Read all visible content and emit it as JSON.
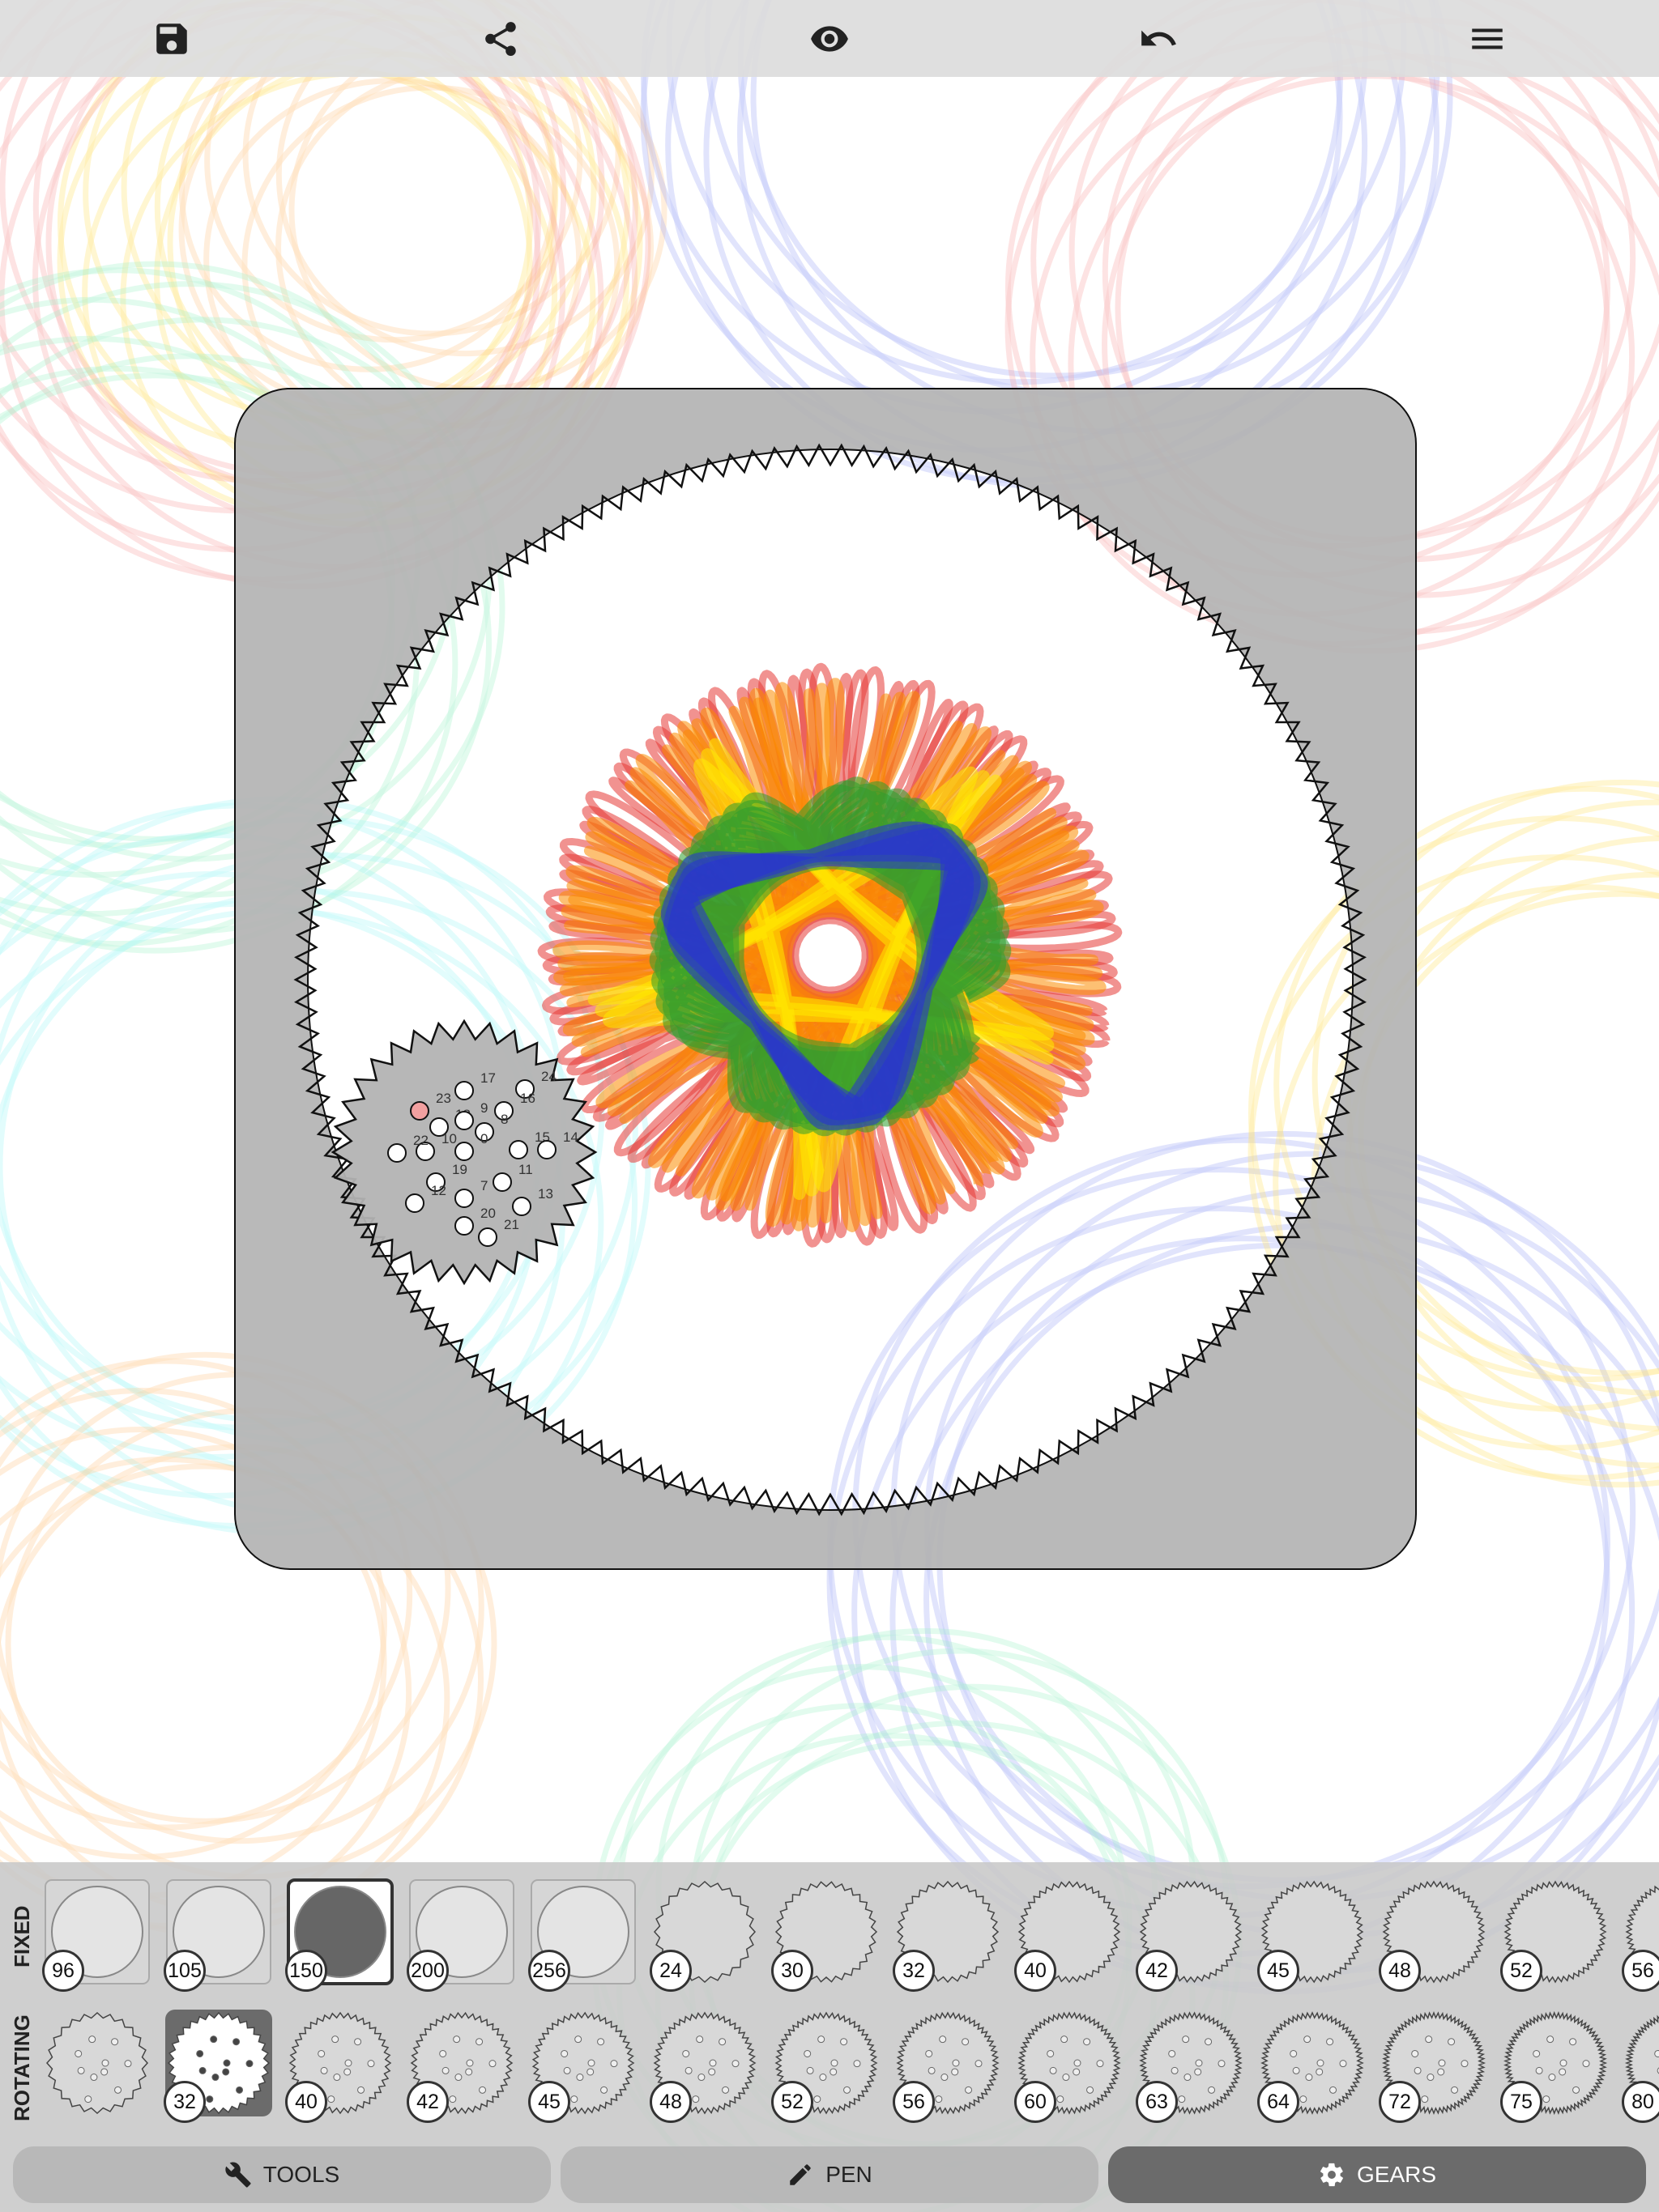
{
  "toolbar": {
    "buttons": [
      {
        "name": "save-button",
        "icon": "save-icon"
      },
      {
        "name": "share-button",
        "icon": "share-icon"
      },
      {
        "name": "preview-button",
        "icon": "eye-icon"
      },
      {
        "name": "undo-button",
        "icon": "undo-icon"
      },
      {
        "name": "menu-button",
        "icon": "menu-icon"
      }
    ]
  },
  "canvas": {
    "background": "#ffffff",
    "board_color": "#b3b3b3",
    "trace_colors": [
      "#e53935",
      "#fb8c00",
      "#ffeb00",
      "#2e9e2e",
      "#2832d6"
    ],
    "faded_colors": [
      "#f7a3a3",
      "#ffe066",
      "#9ff0c8",
      "#9aa6f5",
      "#ffc98a",
      "#9ef5f5"
    ]
  },
  "rotating_gear": {
    "hole_labels": [
      "17",
      "24",
      "16",
      "23",
      "18",
      "9",
      "8",
      "15",
      "10",
      "0",
      "22",
      "14",
      "19",
      "11",
      "7",
      "12",
      "13",
      "20",
      "21"
    ]
  },
  "gear_panel": {
    "fixed_label": "FIXED",
    "rotating_label": "ROTATING",
    "fixed": [
      {
        "label": "96",
        "kind": "ring"
      },
      {
        "label": "105",
        "kind": "ring"
      },
      {
        "label": "150",
        "kind": "ring",
        "selected": true
      },
      {
        "label": "200",
        "kind": "ring"
      },
      {
        "label": "256",
        "kind": "ring"
      },
      {
        "label": "24",
        "kind": "gear"
      },
      {
        "label": "30",
        "kind": "gear"
      },
      {
        "label": "32",
        "kind": "gear"
      },
      {
        "label": "40",
        "kind": "gear"
      },
      {
        "label": "42",
        "kind": "gear"
      },
      {
        "label": "45",
        "kind": "gear"
      },
      {
        "label": "48",
        "kind": "gear"
      },
      {
        "label": "52",
        "kind": "gear"
      },
      {
        "label": "56",
        "kind": "gear"
      }
    ],
    "rotating": [
      {
        "label": "",
        "kind": "gear"
      },
      {
        "label": "32",
        "kind": "gear",
        "selected": true
      },
      {
        "label": "40",
        "kind": "gear"
      },
      {
        "label": "42",
        "kind": "gear"
      },
      {
        "label": "45",
        "kind": "gear"
      },
      {
        "label": "48",
        "kind": "gear"
      },
      {
        "label": "52",
        "kind": "gear"
      },
      {
        "label": "56",
        "kind": "gear"
      },
      {
        "label": "60",
        "kind": "gear"
      },
      {
        "label": "63",
        "kind": "gear"
      },
      {
        "label": "64",
        "kind": "gear"
      },
      {
        "label": "72",
        "kind": "gear"
      },
      {
        "label": "75",
        "kind": "gear"
      },
      {
        "label": "80",
        "kind": "gear"
      }
    ]
  },
  "tabs": [
    {
      "label": "TOOLS",
      "icon": "wrench-icon",
      "active": false
    },
    {
      "label": "PEN",
      "icon": "pencil-icon",
      "active": false
    },
    {
      "label": "GEARS",
      "icon": "gear-icon",
      "active": true
    }
  ]
}
